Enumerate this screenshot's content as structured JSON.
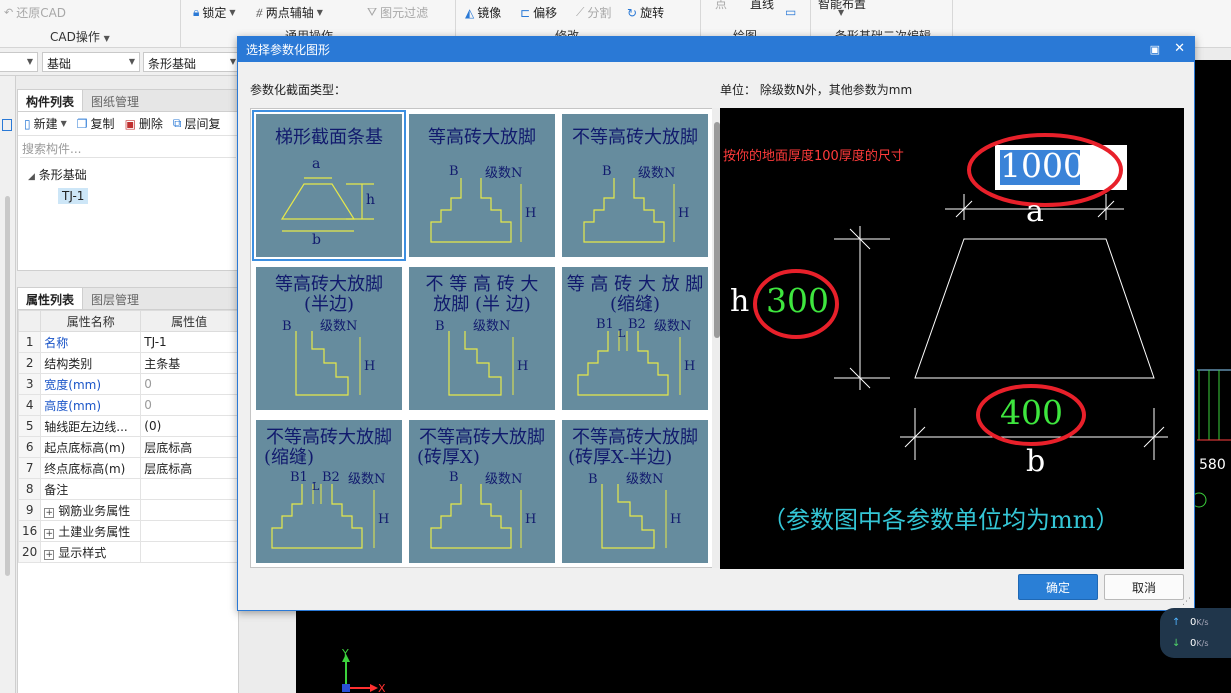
{
  "ribbon": {
    "restore_cad": "还原CAD",
    "cad_ops": "CAD操作",
    "lock": "锁定",
    "two_point_aux": "两点辅轴",
    "layer_filter": "图元过滤",
    "general_ops": "通用操作",
    "mirror": "镜像",
    "offset": "偏移",
    "split": "分割",
    "rotate": "旋转",
    "modify": "修改",
    "point": "点",
    "line": "直线",
    "draw": "绘图",
    "smart_layout": "智能布置",
    "edit_partial": "条形基础二次编辑"
  },
  "combobar": {
    "combo_basic": "基础",
    "combo_type": "条形基础"
  },
  "component_panel": {
    "tab_list": "构件列表",
    "tab_drawing": "图纸管理",
    "btn_new": "新建",
    "btn_copy": "复制",
    "btn_delete": "删除",
    "btn_layer_copy": "层间复",
    "search_placeholder": "搜索构件...",
    "tree_parent": "条形基础",
    "tree_child": "TJ-1"
  },
  "property_panel": {
    "tab_props": "属性列表",
    "tab_layers": "图层管理",
    "col_name": "属性名称",
    "col_value": "属性值",
    "rows": [
      {
        "no": "1",
        "name": "名称",
        "value": "TJ-1"
      },
      {
        "no": "2",
        "name": "结构类别",
        "value": "主条基"
      },
      {
        "no": "3",
        "name": "宽度(mm)",
        "value": "0"
      },
      {
        "no": "4",
        "name": "高度(mm)",
        "value": "0"
      },
      {
        "no": "5",
        "name": "轴线距左边线...",
        "value": "(0)"
      },
      {
        "no": "6",
        "name": "起点底标高(m)",
        "value": "层底标高"
      },
      {
        "no": "7",
        "name": "终点底标高(m)",
        "value": "层底标高"
      },
      {
        "no": "8",
        "name": "备注",
        "value": ""
      },
      {
        "no": "9",
        "name": "钢筋业务属性",
        "value": ""
      },
      {
        "no": "16",
        "name": "土建业务属性",
        "value": ""
      },
      {
        "no": "20",
        "name": "显示样式",
        "value": ""
      }
    ]
  },
  "dialog": {
    "title": "选择参数化图形",
    "section_label": "参数化截面类型：",
    "unit_note": "单位： 除级数N外，其他参数为mm",
    "tiles": [
      {
        "title1": "梯形截面条基",
        "title2": "",
        "labels": [
          "a",
          "h",
          "b"
        ]
      },
      {
        "title1": "等高砖大放脚",
        "title2": "",
        "labels": [
          "B",
          "级数N",
          "H"
        ]
      },
      {
        "title1": "不等高砖大放脚",
        "title2": "",
        "labels": [
          "B",
          "级数N",
          "H"
        ]
      },
      {
        "title1": "等高砖大放脚",
        "title2": "(半边)",
        "labels": [
          "B",
          "级数N",
          "H"
        ]
      },
      {
        "title1": "不 等 高 砖 大",
        "title2": "放脚 (半 边)",
        "labels": [
          "B",
          "级数N",
          "H"
        ]
      },
      {
        "title1": "等 高 砖 大 放 脚",
        "title2": "(缩缝)",
        "labels": [
          "B1",
          "B2",
          "级数N",
          "H",
          "L"
        ]
      },
      {
        "title1": "不等高砖大放脚",
        "title2": "(缩缝)",
        "labels": [
          "B1",
          "B2",
          "级数N",
          "H",
          "L"
        ]
      },
      {
        "title1": "不等高砖大放脚",
        "title2": "(砖厚X)",
        "labels": [
          "B",
          "级数N",
          "H"
        ]
      },
      {
        "title1": "不等高砖大放脚",
        "title2": "(砖厚X-半边)",
        "labels": [
          "B",
          "级数N",
          "H"
        ]
      }
    ],
    "preview": {
      "annotation": "按你的地面厚度100厚度的尺寸",
      "a_value": "1000",
      "h_value": "300",
      "b_value": "400",
      "label_a": "a",
      "label_h": "h",
      "label_b": "b",
      "footnote": "（参数图中各参数单位均为mm）"
    },
    "ok": "确定",
    "cancel": "取消"
  },
  "canvas": {
    "right_value": "580",
    "axis_y": "Y",
    "axis_x": "X"
  },
  "stats": {
    "up": "0",
    "up_unit": "K/s",
    "down": "0",
    "down_unit": "K/s"
  }
}
